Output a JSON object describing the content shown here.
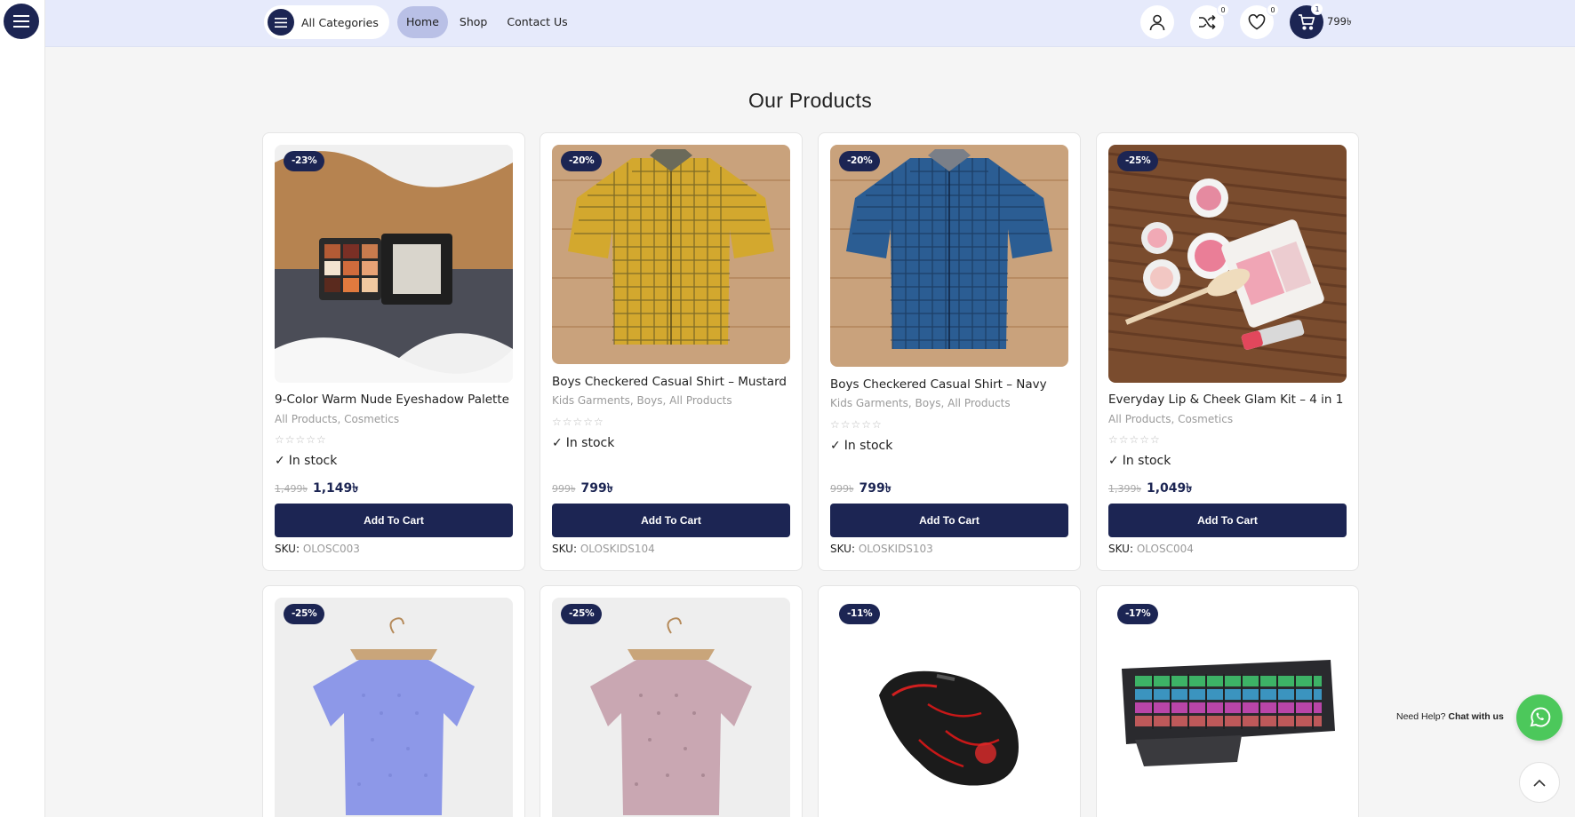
{
  "header": {
    "categories_label": "All Categories",
    "nav": [
      "Home",
      "Shop",
      "Contact Us"
    ],
    "compare_count": "0",
    "wishlist_count": "0",
    "cart_count": "1",
    "cart_total": "799৳"
  },
  "page": {
    "title": "Our Products"
  },
  "products": [
    {
      "name": "9-Color Warm Nude Eyeshadow Palette",
      "discount": "-23%",
      "categories": [
        "All Products",
        "Cosmetics"
      ],
      "rating": "☆☆☆☆☆",
      "stock": "In stock",
      "old_price": "1,499৳",
      "price": "1,149৳",
      "cart_label": "Add To Cart",
      "sku_label": "SKU:",
      "sku": "OLOSC003"
    },
    {
      "name": "Boys Checkered Casual Shirt – Mustard",
      "discount": "-20%",
      "categories": [
        "Kids Garments",
        "Boys",
        "All Products"
      ],
      "rating": "☆☆☆☆☆",
      "stock": "In stock",
      "old_price": "999৳",
      "price": "799৳",
      "cart_label": "Add To Cart",
      "sku_label": "SKU:",
      "sku": "OLOSKIDS104"
    },
    {
      "name": "Boys Checkered Casual Shirt – Navy",
      "discount": "-20%",
      "categories": [
        "Kids Garments",
        "Boys",
        "All Products"
      ],
      "rating": "☆☆☆☆☆",
      "stock": "In stock",
      "old_price": "999৳",
      "price": "799৳",
      "cart_label": "Add To Cart",
      "sku_label": "SKU:",
      "sku": "OLOSKIDS103"
    },
    {
      "name": "Everyday Lip & Cheek Glam Kit – 4 in 1",
      "discount": "-25%",
      "categories": [
        "All Products",
        "Cosmetics"
      ],
      "rating": "☆☆☆☆☆",
      "stock": "In stock",
      "old_price": "1,399৳",
      "price": "1,049৳",
      "cart_label": "Add To Cart",
      "sku_label": "SKU:",
      "sku": "OLOSC004"
    },
    {
      "discount": "-25%"
    },
    {
      "discount": "-25%"
    },
    {
      "discount": "-11%"
    },
    {
      "discount": "-17%"
    }
  ],
  "help": {
    "prefix": "Need Help?",
    "link": "Chat with us"
  },
  "colors": {
    "primary": "#1c2553",
    "header_bg": "#e6eafb",
    "whatsapp": "#4cc85b"
  }
}
